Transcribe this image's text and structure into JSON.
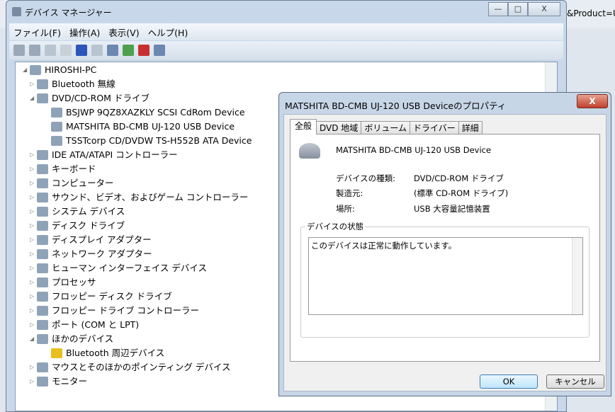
{
  "background": {
    "url_tail": "&Product=U"
  },
  "window": {
    "title": "デバイス マネージャー",
    "controls": [
      "—",
      "□",
      "X"
    ],
    "menu": [
      "ファイル(F)",
      "操作(A)",
      "表示(V)",
      "ヘルプ(H)"
    ],
    "toolbar": [
      "back-icon",
      "forward-icon",
      "console-tree-icon",
      "properties-icon",
      "help-icon",
      "action-pane-icon",
      "scan-hardware-icon",
      "update-driver-icon",
      "uninstall-icon",
      "disable-icon"
    ]
  },
  "tree": [
    {
      "label": "HIROSHI-PC",
      "level": 0,
      "expanded": true
    },
    {
      "label": "Bluetooth 無線",
      "level": 1
    },
    {
      "label": "DVD/CD-ROM ドライブ",
      "level": 1,
      "expanded": true
    },
    {
      "label": "BSJWP 9QZ8XAZKLY SCSI CdRom Device",
      "level": 2
    },
    {
      "label": "MATSHITA BD-CMB UJ-120 USB Device",
      "level": 2
    },
    {
      "label": "TSSTcorp CD/DVDW TS-H552B ATA Device",
      "level": 2
    },
    {
      "label": "IDE ATA/ATAPI コントローラー",
      "level": 1
    },
    {
      "label": "キーボード",
      "level": 1
    },
    {
      "label": "コンピューター",
      "level": 1
    },
    {
      "label": "サウンド、ビデオ、およびゲーム コントローラー",
      "level": 1
    },
    {
      "label": "システム デバイス",
      "level": 1
    },
    {
      "label": "ディスク ドライブ",
      "level": 1
    },
    {
      "label": "ディスプレイ アダプター",
      "level": 1
    },
    {
      "label": "ネットワーク アダプター",
      "level": 1
    },
    {
      "label": "ヒューマン インターフェイス デバイス",
      "level": 1
    },
    {
      "label": "プロセッサ",
      "level": 1
    },
    {
      "label": "フロッピー ディスク ドライブ",
      "level": 1
    },
    {
      "label": "フロッピー ドライブ コントローラー",
      "level": 1
    },
    {
      "label": "ポート (COM と LPT)",
      "level": 1
    },
    {
      "label": "ほかのデバイス",
      "level": 1,
      "expanded": true
    },
    {
      "label": "Bluetooth 周辺デバイス",
      "level": 2,
      "warning": true
    },
    {
      "label": "マウスとそのほかのポインティング デバイス",
      "level": 1
    },
    {
      "label": "モニター",
      "level": 1
    }
  ],
  "dialog": {
    "title": "MATSHITA BD-CMB UJ-120 USB Deviceのプロパティ",
    "close": "X",
    "tabs": [
      "全般",
      "DVD 地域",
      "ボリューム",
      "ドライバー",
      "詳細"
    ],
    "device_name": "MATSHITA BD-CMB UJ-120 USB Device",
    "props": [
      {
        "label": "デバイスの種類:",
        "value": "DVD/CD-ROM ドライブ"
      },
      {
        "label": "製造元:",
        "value": "(標準 CD-ROM ドライブ)"
      },
      {
        "label": "場所:",
        "value": "USB 大容量記憶装置"
      }
    ],
    "status_label": "デバイスの状態",
    "status_text": "このデバイスは正常に動作しています。",
    "ok": "OK",
    "cancel": "キャンセル"
  }
}
